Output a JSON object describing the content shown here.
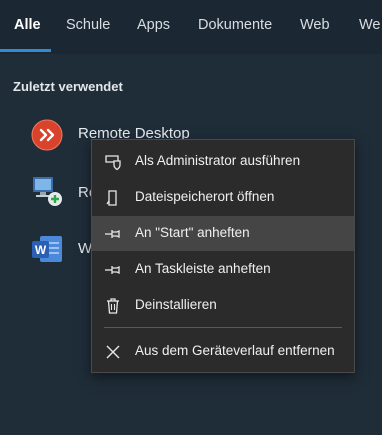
{
  "tabs": [
    {
      "label": "Alle",
      "active": true
    },
    {
      "label": "Schule",
      "active": false
    },
    {
      "label": "Apps",
      "active": false
    },
    {
      "label": "Dokumente",
      "active": false
    },
    {
      "label": "Web",
      "active": false
    },
    {
      "label": "We",
      "active": false
    }
  ],
  "recent": {
    "heading": "Zuletzt verwendet",
    "items": [
      {
        "label": "Remote Desktop",
        "icon": "remote-desktop-icon"
      },
      {
        "label": "Re",
        "icon": "computer-network-icon"
      },
      {
        "label": "W",
        "icon": "word-icon"
      }
    ]
  },
  "context_menu": {
    "items": [
      {
        "label": "Als Administrator ausführen",
        "icon": "admin-shield-icon"
      },
      {
        "label": "Dateispeicherort öffnen",
        "icon": "file-location-icon"
      },
      {
        "label": "An \"Start\" anheften",
        "icon": "pin-icon",
        "highlighted": true
      },
      {
        "label": "An Taskleiste anheften",
        "icon": "pin-icon"
      },
      {
        "label": "Deinstallieren",
        "icon": "trash-icon"
      },
      {
        "label": "Aus dem Geräteverlauf entfernen",
        "icon": "close-icon"
      }
    ]
  },
  "colors": {
    "accent": "#2f8ad8",
    "background": "#1f2d39",
    "menu_background": "#2b2b2b",
    "menu_highlight": "#454545",
    "remote_desktop_red": "#d9432c",
    "word_blue": "#2b5fb3"
  }
}
